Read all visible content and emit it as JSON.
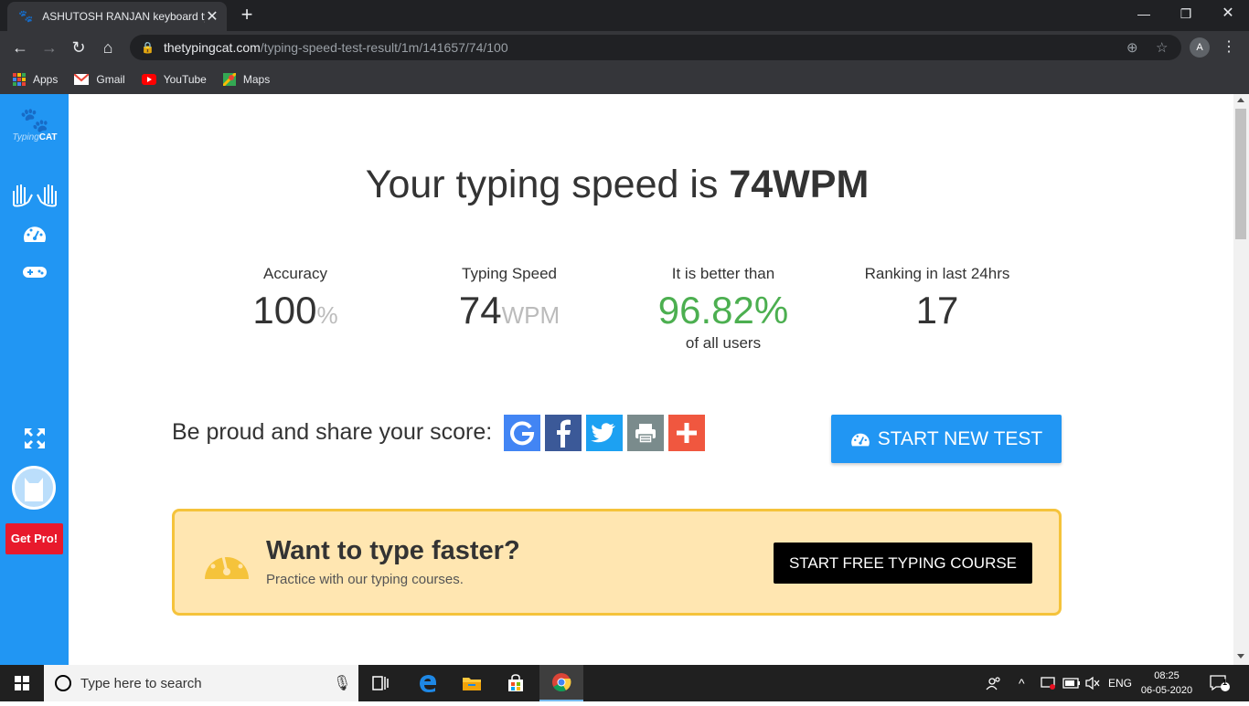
{
  "browser": {
    "tab_title": "ASHUTOSH RANJAN keyboard ty",
    "url_host": "thetypingcat.com",
    "url_path": "/typing-speed-test-result/1m/141657/74/100",
    "profile_initial": "A",
    "bookmarks": [
      {
        "label": "Apps",
        "icon": "apps-grid-icon"
      },
      {
        "label": "Gmail",
        "icon": "gmail-icon"
      },
      {
        "label": "YouTube",
        "icon": "youtube-icon"
      },
      {
        "label": "Maps",
        "icon": "maps-icon"
      }
    ]
  },
  "sidebar": {
    "logo_part1": "Typing",
    "logo_part2": "CAT",
    "get_pro_label": "Get Pro!"
  },
  "result": {
    "headline_prefix": "Your typing speed is ",
    "headline_value": "74WPM",
    "stats": [
      {
        "label": "Accuracy",
        "value": "100",
        "unit": "%",
        "sub": ""
      },
      {
        "label": "Typing Speed",
        "value": "74",
        "unit": "WPM",
        "sub": ""
      },
      {
        "label": "It is better than",
        "value": "96.82%",
        "unit": "",
        "sub": "of all users"
      },
      {
        "label": "Ranking in last 24hrs",
        "value": "17",
        "unit": "",
        "sub": ""
      }
    ],
    "share_text": "Be proud and share your score:",
    "share_buttons": [
      {
        "icon": "google-icon",
        "color": "#4285f4"
      },
      {
        "icon": "facebook-icon",
        "color": "#3b5998"
      },
      {
        "icon": "twitter-icon",
        "color": "#1da1f2"
      },
      {
        "icon": "print-icon",
        "color": "#7a8b8c"
      },
      {
        "icon": "plus-icon",
        "color": "#f0573f"
      }
    ],
    "start_new_test_label": "START NEW TEST"
  },
  "promo": {
    "title": "Want to type faster?",
    "subtitle": "Practice with our typing courses.",
    "button_label": "START FREE TYPING COURSE"
  },
  "taskbar": {
    "search_placeholder": "Type here to search",
    "language": "ENG",
    "time": "08:25",
    "date": "06-05-2020",
    "notification_count": "1"
  },
  "colors": {
    "accent": "#2196f3",
    "green": "#4caf50",
    "promo_bg": "#ffe6b1",
    "promo_border": "#f5c33b",
    "get_pro": "#e8192c"
  }
}
